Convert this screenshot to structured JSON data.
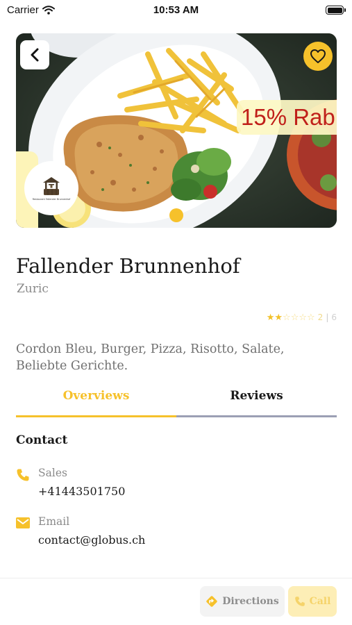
{
  "status_bar": {
    "carrier": "Carrier",
    "time": "10:53 AM"
  },
  "hero": {
    "promo_text": "15% Rab",
    "logo_caption": "Restaurant Fallender Brunnenhof",
    "slide_count": 1,
    "active_slide": 1
  },
  "restaurant": {
    "name": "Fallender Brunnenhof",
    "city": "Zuric",
    "rating": {
      "value": 2,
      "max": 6,
      "stars_filled": 2,
      "stars_total": 6,
      "value_text": "2",
      "separator": "|",
      "max_text": "6"
    },
    "cuisines": "Cordon Bleu, Burger, Pizza, Risotto, Salate, Beliebte Gerichte."
  },
  "tabs": [
    {
      "label": "Overviews",
      "active": true
    },
    {
      "label": "Reviews",
      "active": false
    }
  ],
  "contact": {
    "title": "Contact",
    "sales_label": "Sales",
    "sales_value": "+41443501750",
    "email_label": "Email",
    "email_value": "contact@globus.ch"
  },
  "actions": {
    "directions_label": "Directions",
    "call_label": "Call"
  },
  "icons": {
    "back": "chevron-left-icon",
    "favorite": "heart-icon",
    "phone": "phone-icon",
    "email": "envelope-icon",
    "directions": "directions-icon",
    "wifi": "wifi-icon",
    "battery": "battery-icon"
  },
  "colors": {
    "accent": "#f6c12b",
    "promo_text": "#c0201a",
    "tab_inactive_line": "#9b9fb4",
    "muted_text": "#8a8a8a"
  }
}
